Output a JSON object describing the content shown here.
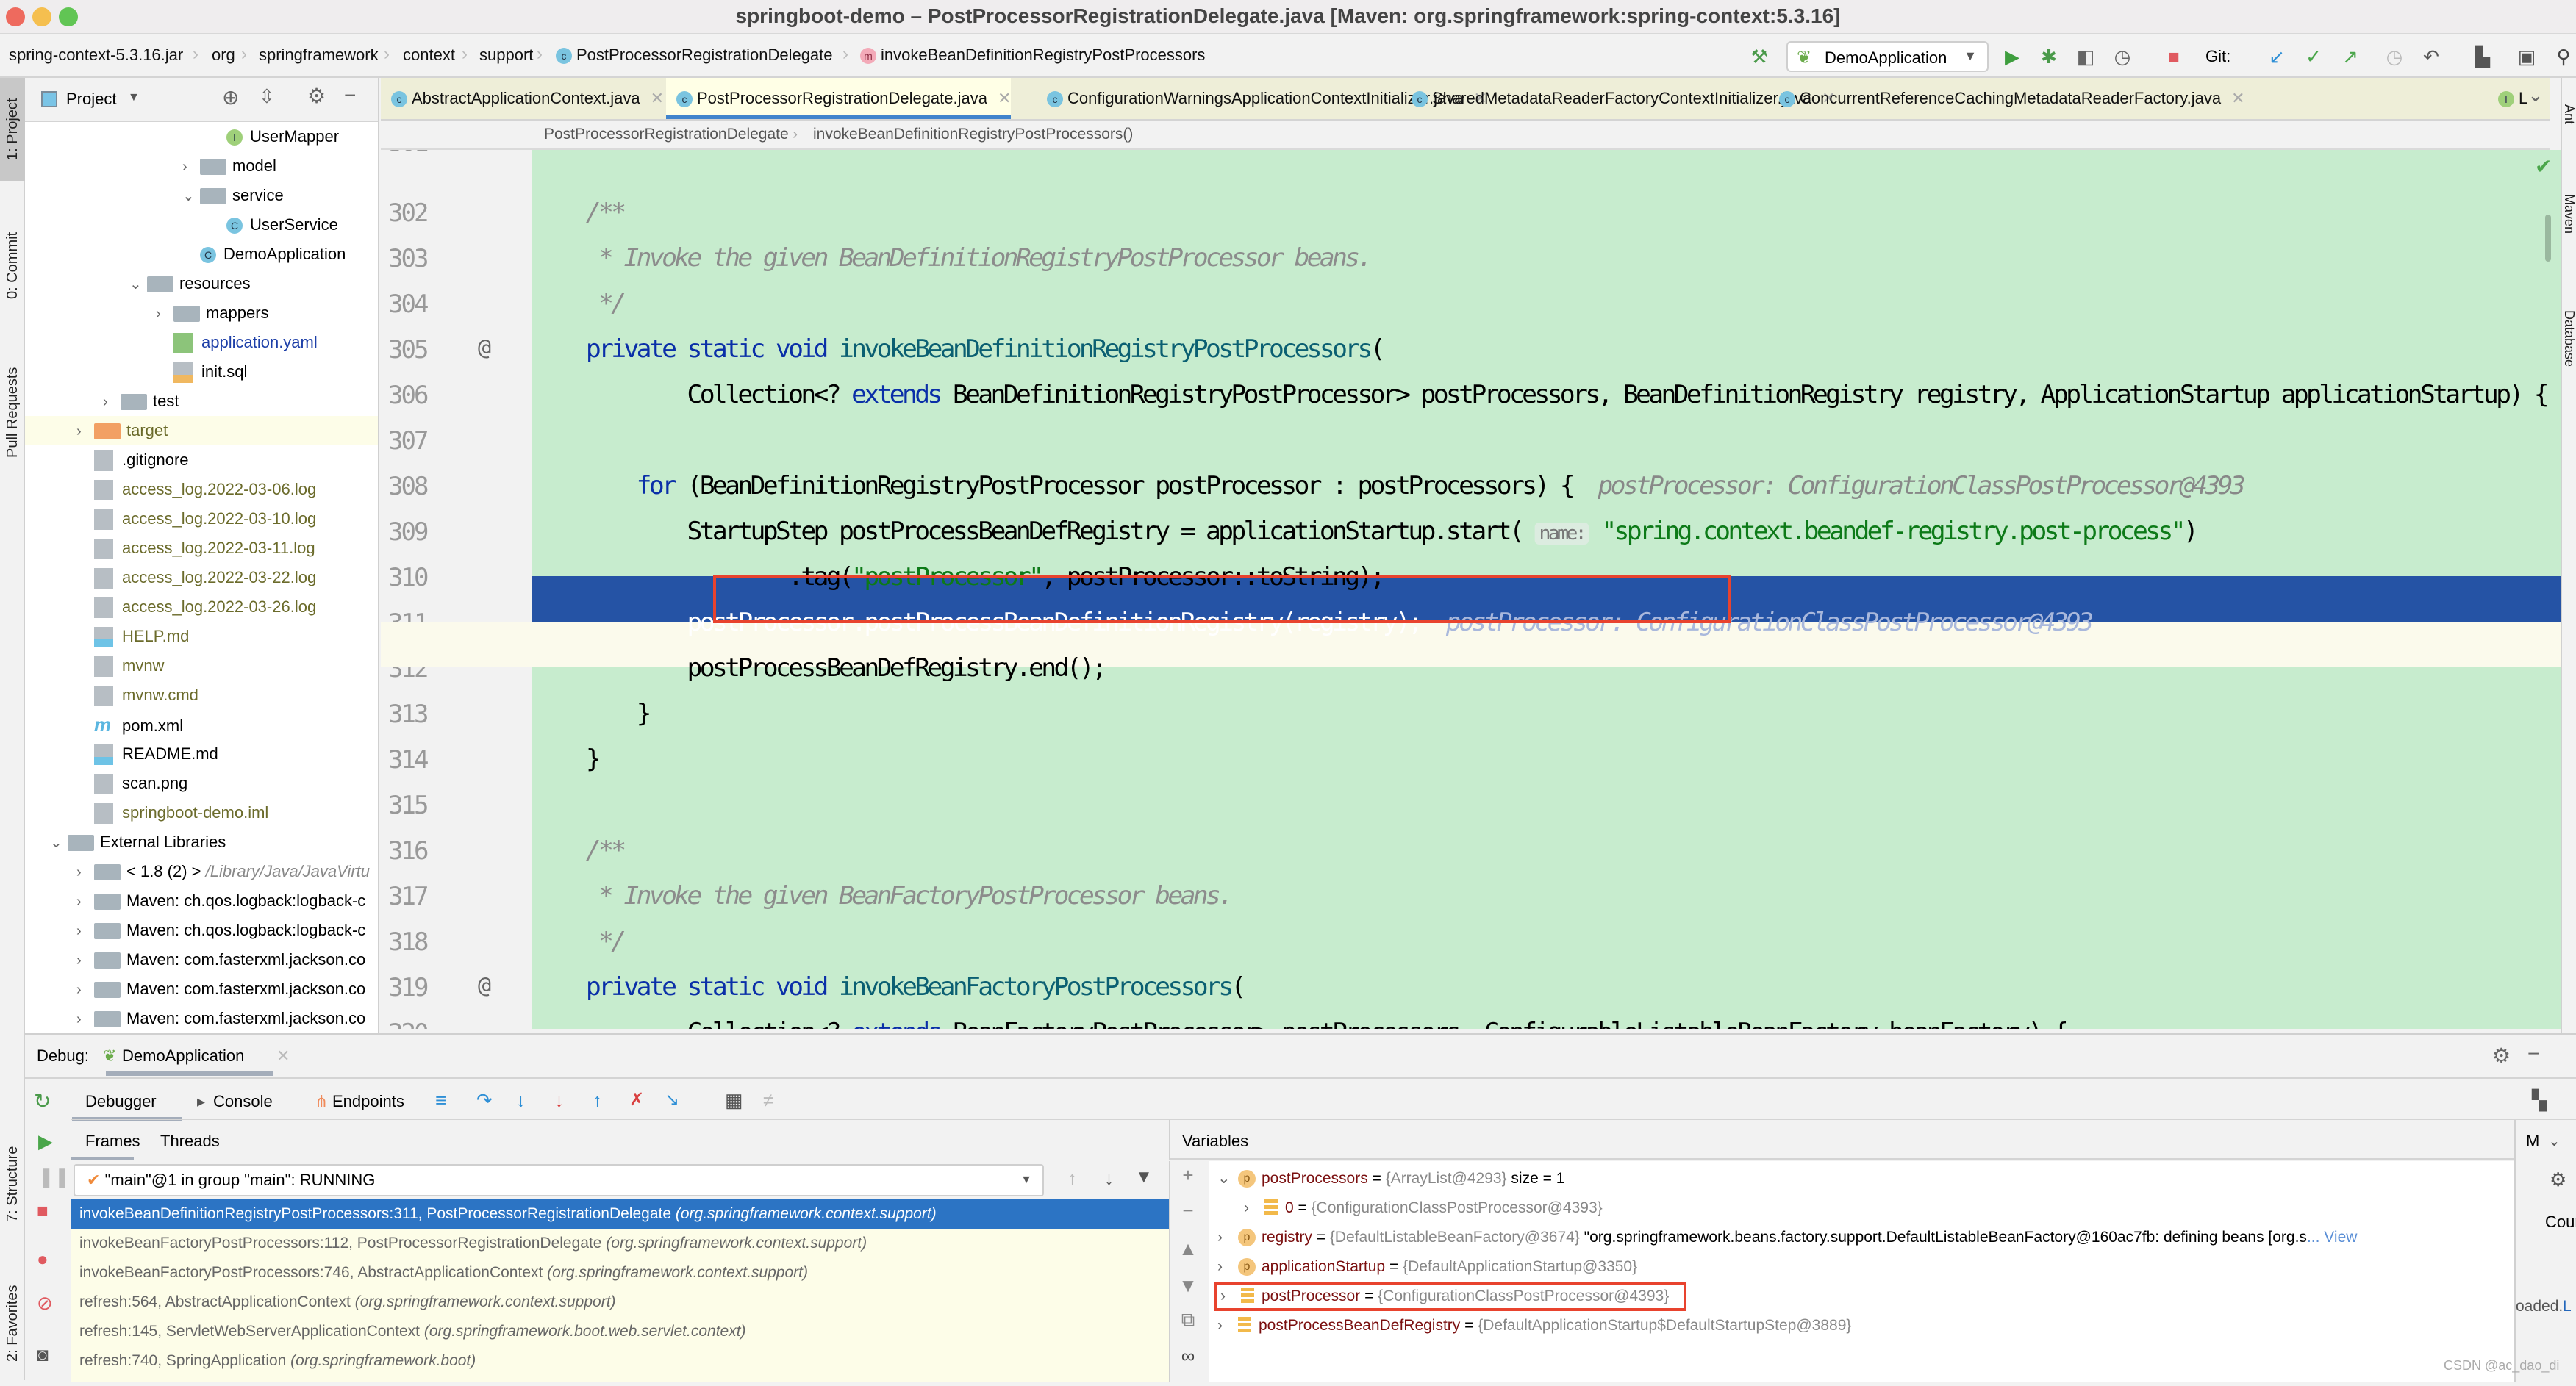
{
  "window": {
    "title": "springboot-demo – PostProcessorRegistrationDelegate.java [Maven: org.springframework:spring-context:5.3.16]"
  },
  "navbar": {
    "breadcrumbs": [
      "spring-context-5.3.16.jar",
      "org",
      "springframework",
      "context",
      "support",
      "PostProcessorRegistrationDelegate",
      "invokeBeanDefinitionRegistryPostProcessors"
    ],
    "run_config": "DemoApplication",
    "git_label": "Git:"
  },
  "left_strip": {
    "tabs": [
      "1: Project",
      "0: Commit",
      "Pull Requests",
      "7: Structure",
      "2: Favorites"
    ]
  },
  "right_strip": {
    "tabs": [
      "Ant",
      "Maven",
      "Database"
    ]
  },
  "project": {
    "title": "Project",
    "tree": [
      {
        "label": "UserMapper",
        "type": "interface",
        "indent": 5,
        "arrow": ""
      },
      {
        "label": "model",
        "type": "package",
        "indent": 4,
        "arrow": "›"
      },
      {
        "label": "service",
        "type": "package",
        "indent": 4,
        "arrow": "⌄"
      },
      {
        "label": "UserService",
        "type": "class",
        "indent": 5,
        "arrow": ""
      },
      {
        "label": "DemoApplication",
        "type": "springclass",
        "indent": 4,
        "arrow": ""
      },
      {
        "label": "resources",
        "type": "resfolder",
        "indent": 2,
        "arrow": "⌄"
      },
      {
        "label": "mappers",
        "type": "folder",
        "indent": 3,
        "arrow": "›"
      },
      {
        "label": "application.yaml",
        "type": "yaml",
        "indent": 3,
        "arrow": ""
      },
      {
        "label": "init.sql",
        "type": "sql",
        "indent": 3,
        "arrow": ""
      },
      {
        "label": "test",
        "type": "folder",
        "indent": 1,
        "arrow": "›"
      },
      {
        "label": "target",
        "type": "excluded",
        "indent": 0,
        "arrow": "›"
      },
      {
        "label": ".gitignore",
        "type": "file",
        "indent": 0,
        "arrow": ""
      },
      {
        "label": "access_log.2022-03-06.log",
        "type": "log",
        "indent": 0,
        "arrow": ""
      },
      {
        "label": "access_log.2022-03-10.log",
        "type": "log",
        "indent": 0,
        "arrow": ""
      },
      {
        "label": "access_log.2022-03-11.log",
        "type": "log",
        "indent": 0,
        "arrow": ""
      },
      {
        "label": "access_log.2022-03-22.log",
        "type": "log",
        "indent": 0,
        "arrow": ""
      },
      {
        "label": "access_log.2022-03-26.log",
        "type": "log",
        "indent": 0,
        "arrow": ""
      },
      {
        "label": "HELP.md",
        "type": "md",
        "indent": 0,
        "arrow": ""
      },
      {
        "label": "mvnw",
        "type": "shell",
        "indent": 0,
        "arrow": ""
      },
      {
        "label": "mvnw.cmd",
        "type": "log",
        "indent": 0,
        "arrow": ""
      },
      {
        "label": "pom.xml",
        "type": "maven",
        "indent": 0,
        "arrow": ""
      },
      {
        "label": "README.md",
        "type": "md",
        "indent": 0,
        "arrow": ""
      },
      {
        "label": "scan.png",
        "type": "image",
        "indent": 0,
        "arrow": ""
      },
      {
        "label": "springboot-demo.iml",
        "type": "iml",
        "indent": 0,
        "arrow": ""
      },
      {
        "label": "External Libraries",
        "type": "libs",
        "indent": -1,
        "arrow": "⌄"
      },
      {
        "label": "< 1.8 (2) >",
        "suffix": "/Library/Java/JavaVirtu",
        "type": "jdk",
        "indent": 0,
        "arrow": "›"
      },
      {
        "label": "Maven: ch.qos.logback:logback-c",
        "type": "lib",
        "indent": 0,
        "arrow": "›"
      },
      {
        "label": "Maven: ch.qos.logback:logback-c",
        "type": "lib",
        "indent": 0,
        "arrow": "›"
      },
      {
        "label": "Maven: com.fasterxml.jackson.co",
        "type": "lib",
        "indent": 0,
        "arrow": "›"
      },
      {
        "label": "Maven: com.fasterxml.jackson.co",
        "type": "lib",
        "indent": 0,
        "arrow": "›"
      },
      {
        "label": "Maven: com.fasterxml.jackson.co",
        "type": "lib",
        "indent": 0,
        "arrow": "›"
      }
    ]
  },
  "editor": {
    "tabs": [
      {
        "label": "AbstractApplicationContext.java",
        "active": false
      },
      {
        "label": "PostProcessorRegistrationDelegate.java",
        "active": true
      },
      {
        "label": "ConfigurationWarningsApplicationContextInitializer.java",
        "active": false
      },
      {
        "label": "SharedMetadataReaderFactoryContextInitializer.java",
        "active": false
      },
      {
        "label": "ConcurrentReferenceCachingMetadataReaderFactory.java",
        "active": false
      },
      {
        "label": "L",
        "active": false
      }
    ],
    "breadcrumb": [
      "PostProcessorRegistrationDelegate",
      "invokeBeanDefinitionRegistryPostProcessors()"
    ],
    "lines": [
      {
        "n": "302",
        "html": "    <span class='cm'>/**</span>"
      },
      {
        "n": "303",
        "html": "     <span class='cm'>* Invoke the given BeanDefinitionRegistryPostProcessor beans.</span>"
      },
      {
        "n": "304",
        "html": "     <span class='cm'>*/</span>"
      },
      {
        "n": "305",
        "at": true,
        "html": "    <span class='kw'>private static void</span> <span class='fn'>invokeBeanDefinitionRegistryPostProcessors</span>("
      },
      {
        "n": "306",
        "html": "            Collection&lt;? <span class='kw'>extends</span> BeanDefinitionRegistryPostProcessor&gt; postProcessors, BeanDefinitionRegistry registry, ApplicationStartup applicationStartup) {"
      },
      {
        "n": "307",
        "html": ""
      },
      {
        "n": "308",
        "html": "        <span class='kw'>for</span> (BeanDefinitionRegistryPostProcessor postProcessor : postProcessors) {  <span class='hint'>postProcessor: ConfigurationClassPostProcessor@4393</span>"
      },
      {
        "n": "309",
        "html": "            StartupStep postProcessBeanDefRegistry = applicationStartup.start( <span class='hintbox'>name:</span> <span class='st'>\"spring.context.beandef-registry.post-process\"</span>)"
      },
      {
        "n": "310",
        "html": "                    .tag(<span class='st'>\"postProcessor\"</span>, postProcessor::toString);"
      },
      {
        "n": "311",
        "exec": true,
        "html": "            <span style='color:#fff'>postProcessor.postProcessBeanDefinitionRegistry(registry);</span>  <span style='color:#a9b8dc;font-style:italic'>postProcessor: ConfigurationClassPostProcessor@4393</span>"
      },
      {
        "n": "312",
        "html": "            postProcessBeanDefRegistry.end();"
      },
      {
        "n": "313",
        "html": "        }"
      },
      {
        "n": "314",
        "html": "    }"
      },
      {
        "n": "315",
        "html": ""
      },
      {
        "n": "316",
        "html": "    <span class='cm'>/**</span>"
      },
      {
        "n": "317",
        "html": "     <span class='cm'>* Invoke the given BeanFactoryPostProcessor beans.</span>"
      },
      {
        "n": "318",
        "html": "     <span class='cm'>*/</span>"
      },
      {
        "n": "319",
        "at": true,
        "html": "    <span class='kw'>private static void</span> <span class='fn'>invokeBeanFactoryPostProcessors</span>("
      },
      {
        "n": "320",
        "html": "            Collection&lt;? <span class='kw'>extends</span> BeanFactoryPostProcessor&gt; postProcessors, ConfigurableListableBeanFactory beanFactory) {"
      }
    ]
  },
  "debug": {
    "label": "Debug:",
    "session": "DemoApplication",
    "tabs": [
      "Debugger",
      "Console",
      "Endpoints"
    ],
    "subtabs": [
      "Frames",
      "Threads"
    ],
    "thread_select": "\"main\"@1 in group \"main\": RUNNING",
    "frames": [
      {
        "method": "invokeBeanDefinitionRegistryPostProcessors:311, PostProcessorRegistrationDelegate",
        "pkg": "(org.springframework.context.support)",
        "selected": true
      },
      {
        "method": "invokeBeanFactoryPostProcessors:112, PostProcessorRegistrationDelegate",
        "pkg": "(org.springframework.context.support)",
        "selected": false
      },
      {
        "method": "invokeBeanFactoryPostProcessors:746, AbstractApplicationContext",
        "pkg": "(org.springframework.context.support)",
        "selected": false
      },
      {
        "method": "refresh:564, AbstractApplicationContext",
        "pkg": "(org.springframework.context.support)",
        "selected": false
      },
      {
        "method": "refresh:145, ServletWebServerApplicationContext",
        "pkg": "(org.springframework.boot.web.servlet.context)",
        "selected": false
      },
      {
        "method": "refresh:740, SpringApplication",
        "pkg": "(org.springframework.boot)",
        "selected": false
      }
    ],
    "variables_title": "Variables",
    "variables": [
      {
        "arrow": "⌄",
        "badge": "p",
        "name": "postProcessors",
        "value": "{ArrayList@4293}",
        "extra": " size = 1",
        "indent": 0
      },
      {
        "arrow": "›",
        "badge": "f",
        "name": "0",
        "value": "{ConfigurationClassPostProcessor@4393}",
        "extra": "",
        "indent": 1
      },
      {
        "arrow": "›",
        "badge": "p",
        "name": "registry",
        "value": "{DefaultListableBeanFactory@3674}",
        "extra": " \"org.springframework.beans.factory.support.DefaultListableBeanFactory@160ac7fb: defining beans [org.s",
        "link": "... View",
        "indent": 0
      },
      {
        "arrow": "›",
        "badge": "p",
        "name": "applicationStartup",
        "value": "{DefaultApplicationStartup@3350}",
        "extra": "",
        "indent": 0
      },
      {
        "arrow": "›",
        "badge": "f",
        "name": "postProcessor",
        "value": "{ConfigurationClassPostProcessor@4393}",
        "extra": "",
        "indent": 0,
        "boxed": true
      },
      {
        "arrow": "›",
        "badge": "f",
        "name": "postProcessBeanDefRegistry",
        "value": "{DefaultApplicationStartup$DefaultStartupStep@3889}",
        "extra": "",
        "indent": 0
      }
    ],
    "right_panel": {
      "header": "M",
      "count_label": "Cour",
      "loaded_text": "oaded.",
      "link": "L"
    }
  },
  "watermark": "CSDN @ac_dao_di",
  "colors": {
    "exec_line": "#2553a5",
    "highlight_box": "#e8432e",
    "editor_bg": "#c7ecce",
    "selected_frame": "#2c74c4"
  }
}
